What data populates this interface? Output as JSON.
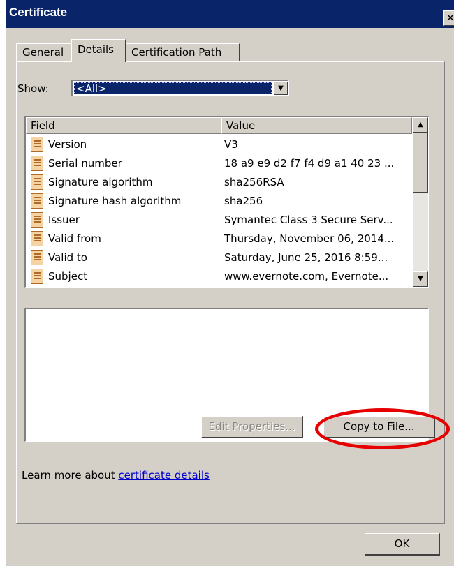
{
  "window": {
    "title": "Certificate",
    "close_glyph": "✕"
  },
  "tabs": [
    {
      "label": "General",
      "active": false
    },
    {
      "label": "Details",
      "active": true
    },
    {
      "label": "Certification Path",
      "active": false
    }
  ],
  "show": {
    "label": "Show:",
    "value": "<All>"
  },
  "list": {
    "headers": {
      "field": "Field",
      "value": "Value"
    },
    "rows": [
      {
        "field": "Version",
        "value": "V3"
      },
      {
        "field": "Serial number",
        "value": "18 a9 e9 d2 f7 f4 d9 a1 40 23 ..."
      },
      {
        "field": "Signature algorithm",
        "value": "sha256RSA"
      },
      {
        "field": "Signature hash algorithm",
        "value": "sha256"
      },
      {
        "field": "Issuer",
        "value": "Symantec Class 3 Secure Serv..."
      },
      {
        "field": "Valid from",
        "value": "Thursday, November 06, 2014..."
      },
      {
        "field": "Valid to",
        "value": "Saturday, June 25, 2016 8:59..."
      },
      {
        "field": "Subject",
        "value": "www.evernote.com, Evernote..."
      }
    ]
  },
  "buttons": {
    "edit_properties": "Edit Properties...",
    "copy_to_file": "Copy to File...",
    "ok": "OK"
  },
  "footer": {
    "learn_prefix": "Learn more about ",
    "learn_link": "certificate details"
  },
  "colors": {
    "titlebar": "#0a246a",
    "dialog_bg": "#d4d0c8",
    "highlight_ring": "#e60000",
    "link": "#0000cc"
  }
}
